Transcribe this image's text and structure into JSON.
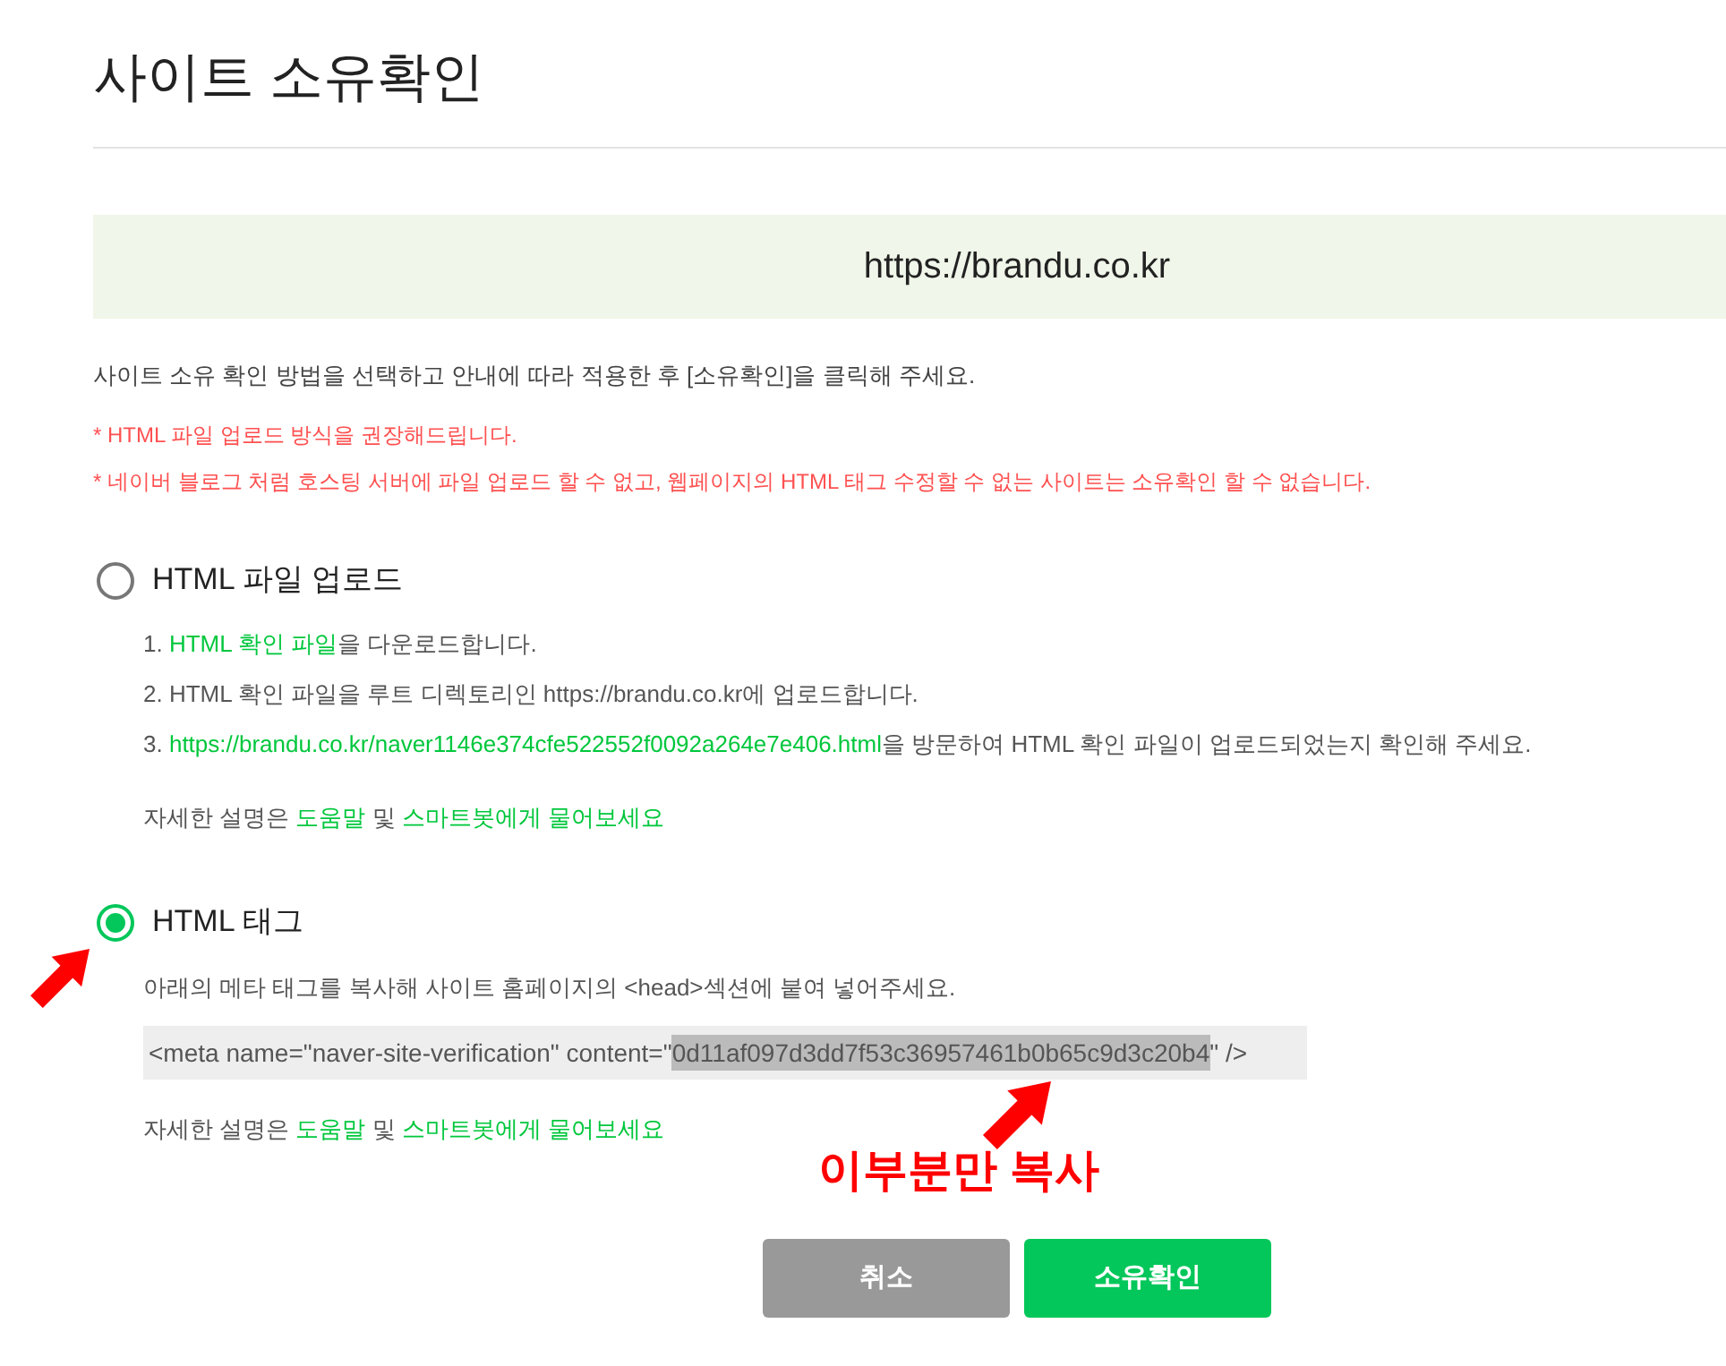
{
  "page": {
    "title": "사이트 소유확인"
  },
  "site": {
    "url": "https://brandu.co.kr"
  },
  "intro": "사이트 소유 확인 방법을 선택하고 안내에 따라 적용한 후 [소유확인]을 클릭해 주세요.",
  "notes": [
    "* HTML 파일 업로드 방식을 권장해드립니다.",
    "* 네이버 블로그 처럼 호스팅 서버에 파일 업로드 할 수 없고, 웹페이지의 HTML 태그 수정할 수 없는 사이트는 소유확인 할 수 없습니다."
  ],
  "methods": [
    {
      "kind": "file",
      "label": "HTML 파일 업로드",
      "selected": false,
      "steps": [
        [
          {
            "text": "1. ",
            "link": false
          },
          {
            "text": "HTML 확인 파일",
            "link": true
          },
          {
            "text": "을 다운로드합니다.",
            "link": false
          }
        ],
        [
          {
            "text": "2. HTML 확인 파일을 루트 디렉토리인 https://brandu.co.kr에 업로드합니다.",
            "link": false
          }
        ],
        [
          {
            "text": "3. ",
            "link": false
          },
          {
            "text": "https://brandu.co.kr/naver1146e374cfe522552f0092a264e7e406.html",
            "link": true
          },
          {
            "text": "을 방문하여 HTML 확인 파일이 업로드되었는지 확인해 주세요.",
            "link": false
          }
        ]
      ],
      "help": [
        {
          "text": "자세한 설명은 ",
          "link": false
        },
        {
          "text": "도움말",
          "link": true
        },
        {
          "text": " 및 ",
          "link": false
        },
        {
          "text": "스마트봇에게 물어보세요",
          "link": true
        }
      ]
    },
    {
      "kind": "tag",
      "label": "HTML 태그",
      "selected": true,
      "instruction": "아래의 메타 태그를 복사해 사이트 홈페이지의 <head>섹션에 붙여 넣어주세요.",
      "meta_tag": [
        {
          "text": "<meta name=\"naver-site-verification\" content=\"",
          "selected": false
        },
        {
          "text": "0d11af097d3dd7f53c36957461b0b65c9d3c20b4",
          "selected": true
        },
        {
          "text": "\" />",
          "selected": false
        }
      ],
      "help": [
        {
          "text": "자세한 설명은 ",
          "link": false
        },
        {
          "text": "도움말",
          "link": true
        },
        {
          "text": " 및 ",
          "link": false
        },
        {
          "text": "스마트봇에게 물어보세요",
          "link": true
        }
      ]
    }
  ],
  "annotation": {
    "label": "이부분만 복사"
  },
  "buttons": [
    {
      "kind": "secondary",
      "label": "취소"
    },
    {
      "kind": "primary",
      "label": "소유확인"
    }
  ]
}
